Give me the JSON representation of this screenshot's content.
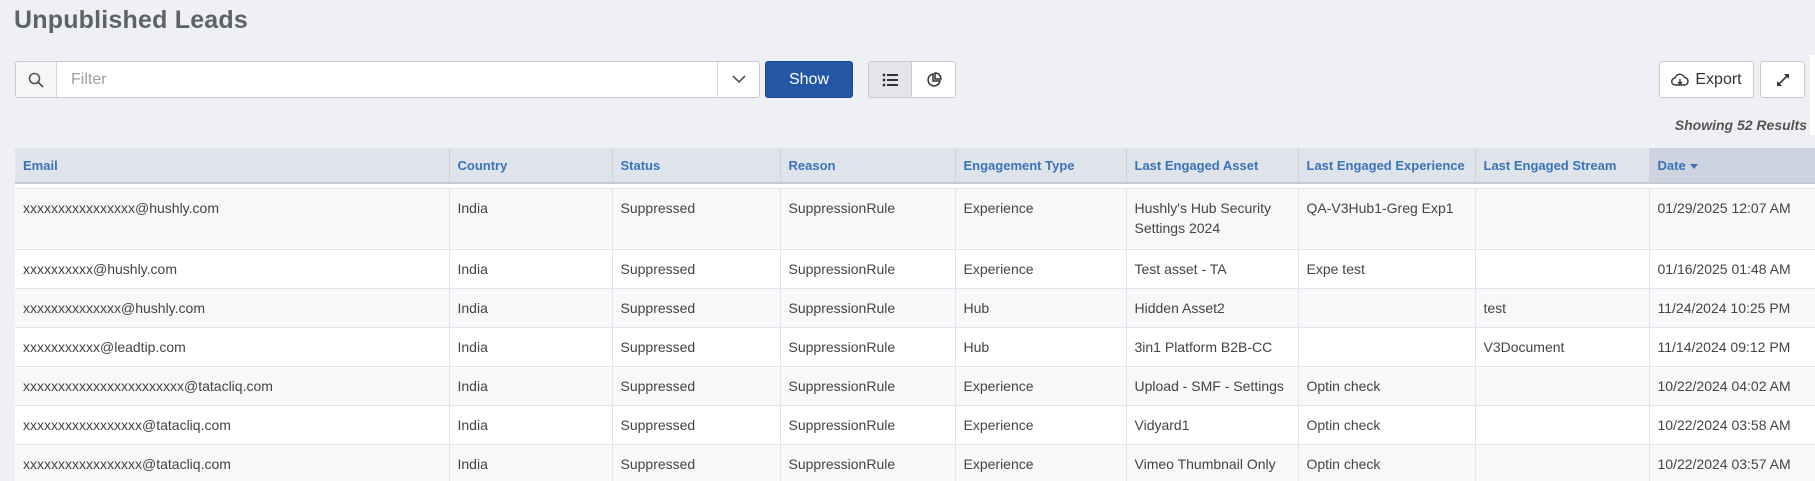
{
  "page": {
    "title": "Unpublished Leads"
  },
  "toolbar": {
    "search_icon": "search-icon",
    "filter_placeholder": "Filter",
    "filter_value": "",
    "dropdown_icon": "chevron-down-icon",
    "show_label": "Show",
    "list_view_icon": "list-icon",
    "chart_view_icon": "pie-chart-icon",
    "export_label": "Export",
    "export_icon": "cloud-download-icon",
    "expand_icon": "expand-icon"
  },
  "results": {
    "label": "Showing 52 Results"
  },
  "table": {
    "columns": [
      "Email",
      "Country",
      "Status",
      "Reason",
      "Engagement Type",
      "Last Engaged Asset",
      "Last Engaged Experience",
      "Last Engaged Stream",
      "Date"
    ],
    "sorted_column": "Date",
    "sort_direction": "desc",
    "rows": [
      {
        "email": "xxxxxxxxxxxxxxxx@hushly.com",
        "country": "India",
        "status": "Suppressed",
        "reason": "SuppressionRule",
        "engagement_type": "Experience",
        "asset": "Hushly's Hub Security Settings 2024",
        "experience": "QA-V3Hub1-Greg Exp1",
        "stream": "",
        "date": "01/29/2025 12:07 AM"
      },
      {
        "email": "xxxxxxxxxx@hushly.com",
        "country": "India",
        "status": "Suppressed",
        "reason": "SuppressionRule",
        "engagement_type": "Experience",
        "asset": "Test asset - TA",
        "experience": "Expe test",
        "stream": "",
        "date": "01/16/2025 01:48 AM"
      },
      {
        "email": "xxxxxxxxxxxxxx@hushly.com",
        "country": "India",
        "status": "Suppressed",
        "reason": "SuppressionRule",
        "engagement_type": "Hub",
        "asset": "Hidden Asset2",
        "experience": "",
        "stream": "test",
        "date": "11/24/2024 10:25 PM"
      },
      {
        "email": "xxxxxxxxxxx@leadtip.com",
        "country": "India",
        "status": "Suppressed",
        "reason": "SuppressionRule",
        "engagement_type": "Hub",
        "asset": "3in1 Platform B2B-CC",
        "experience": "",
        "stream": "V3Document",
        "date": "11/14/2024 09:12 PM"
      },
      {
        "email": "xxxxxxxxxxxxxxxxxxxxxxx@tatacliq.com",
        "country": "India",
        "status": "Suppressed",
        "reason": "SuppressionRule",
        "engagement_type": "Experience",
        "asset": "Upload - SMF - Settings",
        "experience": "Optin check",
        "stream": "",
        "date": "10/22/2024 04:02 AM"
      },
      {
        "email": "xxxxxxxxxxxxxxxxx@tatacliq.com",
        "country": "India",
        "status": "Suppressed",
        "reason": "SuppressionRule",
        "engagement_type": "Experience",
        "asset": "Vidyard1",
        "experience": "Optin check",
        "stream": "",
        "date": "10/22/2024 03:58 AM"
      },
      {
        "email": "xxxxxxxxxxxxxxxxx@tatacliq.com",
        "country": "India",
        "status": "Suppressed",
        "reason": "SuppressionRule",
        "engagement_type": "Experience",
        "asset": "Vimeo Thumbnail Only",
        "experience": "Optin check",
        "stream": "",
        "date": "10/22/2024 03:57 AM"
      }
    ]
  }
}
